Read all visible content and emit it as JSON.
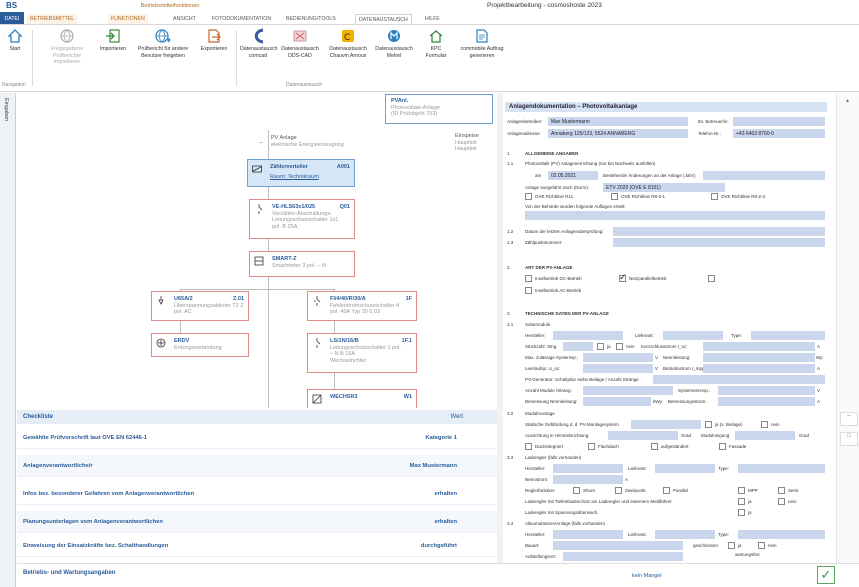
{
  "app": {
    "logo": "BS",
    "window_title": "Projektbearbeitung - cosmoshoste 2023",
    "context_label": "Betriebsmittelfunktionen"
  },
  "tabs": [
    "DATEI",
    "BETRIEBSMITTEL",
    "FUNKTIONEN",
    "ANSICHT",
    "FOTODOKUMENTATION",
    "BEDIENUNG/TOOLS",
    "DATENAUSTAUSCH",
    "HILFE"
  ],
  "ribbon": {
    "start": "Start",
    "navigation_group": "Navigation",
    "freigabe": "Freigegebene Prüfberichte importieren",
    "importieren": "Importieren",
    "pruefbericht": "Prüfbericht für andere Benutzer freigeben",
    "exportieren": "Exportieren",
    "comcad": "Datenaustausch comcad",
    "dds": "Datenaustausch DDS-CAD",
    "chauvin": "Datenaustausch Chauvin Arnoux",
    "metrel": "Datenaustausch Metrel",
    "kpc": "KPC Formular",
    "commobile": "commobile Auftrag generieren",
    "datenaustausch_group": "Datenaustausch"
  },
  "sidebar_label": "Eingaben",
  "tree": {
    "pv_title": "PVAnl.",
    "pv_sub1": "Photovoltaik-Anlage",
    "pv_sub2": "(ID Prüfobjekt 753)",
    "anlage_title": "PV Anlage",
    "anlage_sub": "elektrische Energieerzeugung",
    "einsp_1": "Einspeise",
    "einsp_2": "Hauptleit",
    "einsp_3": "Hauptleit",
    "zaehler_title": "Zählerverteiler",
    "zaehler_code": "A001",
    "zaehler_sub": "Raum: Technikraum",
    "ve_title": "VE-HLS63x1/025",
    "ve_code": "Q01",
    "ve_sub1": "Vorzähler-Abschaltungs-",
    "ve_sub2": "Leitungsschutzschalter 1x1",
    "ve_sub3": "pol. B 25A",
    "smart_title": "SMART-Z",
    "smart_sub": "Smartmeter 3 pol. – N",
    "u65_title": "U65A/2",
    "u65_code": "Z.01",
    "u65_sub1": "Überspannungsableiter T2 2",
    "u65_sub2": "pol. AC",
    "fi_title": "FI/4/40/R/30/A",
    "fi_code": "1F",
    "fi_sub1": "Fehlerstromschutzschalter 4",
    "fi_sub2": "pol. 40A Typ 30 0,03",
    "erdv_title": "ERDV",
    "erdv_sub": "Erdungsverbindung",
    "ls_title": "LS/1N/16/B",
    "ls_code": "1F.1",
    "ls_sub1": "Leitungsschutzschalter 1 pol.",
    "ls_sub2": "– N B 16A",
    "ls_sub3": "Wechselrichter",
    "wr_title": "WECHSR3",
    "wr_code": "W1"
  },
  "checklist": {
    "header": "Checkliste",
    "header_status": "Wert",
    "rows": [
      {
        "label": "Gewählte Prüfvorschrift laut OVE EN 62446-1",
        "value": "Kategorie 1"
      },
      {
        "label": "Anlagenverantwortliche/r",
        "value": "Max Mustermann"
      },
      {
        "label": "Infos bez. besonderer Gefahren vom Anlagenverantwortlichen",
        "value": "erhalten"
      },
      {
        "label": "Planungsunterlagen vom Anlagenverantwortlichen",
        "value": "erhalten"
      },
      {
        "label": "Einweisung der Einsatzkräfte bez. Schalthandlungen",
        "value": "durchgeführt"
      }
    ],
    "footer": "Betriebs- und Wartungsangaben",
    "footer_status": "kein Mangel"
  },
  "document": {
    "title": "Anlagendokumentation – Photovoltaikanlage",
    "anlagenbetreiber_label": "Anlagenbetreiber:",
    "anlagenbetreiber": "Max Mustermann",
    "anlagenadresse_label": "Anlagenadresse:",
    "anlagenadresse": "Annaberg 125/123, 5524 ANNABERG",
    "ansprech_label": "Ev. Betreuer/in:",
    "telefon_label": "Telefon-Nr.:",
    "telefon": "+43 6463 8760-0",
    "s1": "1.",
    "s1_title": "ALLGEMEINE ANGABEN",
    "s11": "1.1",
    "s11_text": "Photovoltaik (PV) Anlagenerrichtung (nur bei Nachweis ausfüllen)",
    "am_label": "am",
    "datum": "02.05.2021",
    "bestehende": "Bestehende Änderungen an der Anlage (Jahr):",
    "norm_label": "Anlage ausgeführt nach (Norm):",
    "norm": "ETV 2020 (OVE E 8101)",
    "ove1": "OVE Richtlinie R11",
    "ove2": "OVE Richtlinie R9-2-1",
    "ove3": "OVE Richtlinie R9-2-2",
    "von_text": "Von der Behörde wurden folgende Auflagen erteilt:",
    "s12": "1.2",
    "s12_text": "Datum der letzten Anlagenüberprüfung:",
    "s13": "1.3",
    "s13_text": "Zählpunktnummer:",
    "s2": "2.",
    "s2_title": "ART DER PV-ANLAGE",
    "insel_dc": "Inselbetrieb DC-Betrieb",
    "netzpar": "Netzparallelbetrieb",
    "insel_ac": "Inselbetrieb AC-Betrieb",
    "s3": "3.",
    "s3_title": "TECHNISCHE DATEN DER PV-ANLAGE",
    "s31": "3.1",
    "s31_text": "Solarmodule",
    "hersteller": "Hersteller:",
    "lieferant": "Lieferant:",
    "type": "Type:",
    "anzahl": "Stückzahl: Stng.",
    "ja": "ja",
    "nein": "nein",
    "kurzschluss": "Kurzschlussstrom I_sc:",
    "a": "A",
    "max_spannung": "Max. zulässige Systemsp.:",
    "v": "V",
    "nennleistung": "Nennleistung:",
    "wp": "Wp",
    "leerlauf": "Leerlaufsp. U_oc:",
    "betriebsstrom": "Betriebsstrom I_mpp:",
    "pv_generator": "PV-Generator: Schaltplan siehe Beilage / Anzahl Stränge",
    "anzahl_module": "Anzahl Module /Strang:",
    "systemnennsp": "Systemnennsp.:",
    "bemessung": "Bemessung Nennleistung:",
    "kwp": "kWp",
    "bemessungsstrom": "Bemessungsstrom:",
    "s32": "3.2",
    "s32_text": "Modulmontage",
    "statische": "Statische Gefährdung d. d. PV-Montagesystem",
    "ja_beilage": "ja (s. Beilage)",
    "ausrichtung": "Ausrichtung in Himmelsrichtung:",
    "grad": "Grad",
    "neigung": "Modulneigung:",
    "dachintegriert": "Dachintegriert",
    "flachdach": "Flachdach",
    "aufgestaendert": "aufgeständert",
    "fassade": "Fassade",
    "s33": "3.3",
    "s33_text": "Laderegler (falls vorhanden)",
    "hersteller2": "Hersteller:",
    "lieferant2": "Lieferant:",
    "type2": "Type:",
    "nennstrom": "Nennstrom:",
    "reglerfunktion": "Reglerfunktion:",
    "shunt": "Shunt",
    "zweipunkt": "Zweipunkt",
    "parallel": "Parallel",
    "mpp": "MPP",
    "serie": "Serie",
    "laderegler_text": "Laderegler mit Tiefentladeschutz am Laderegler und externem Meldführer",
    "laderegler_ueber": "Laderegler mit Spannungsüberwach.",
    "s34": "3.4",
    "s34_text": "Akkumulatoren/Anlage (falls vorhanden)",
    "hersteller3": "Hersteller:",
    "lieferant3": "Lieferant:",
    "type3": "Type:",
    "bauart": "Bauart:",
    "geschlossen": "geschlossen",
    "wartungsfrei": "wartungsfrei",
    "aufstellungsort": "Aufstellungsort:"
  },
  "status_ok": "✓"
}
